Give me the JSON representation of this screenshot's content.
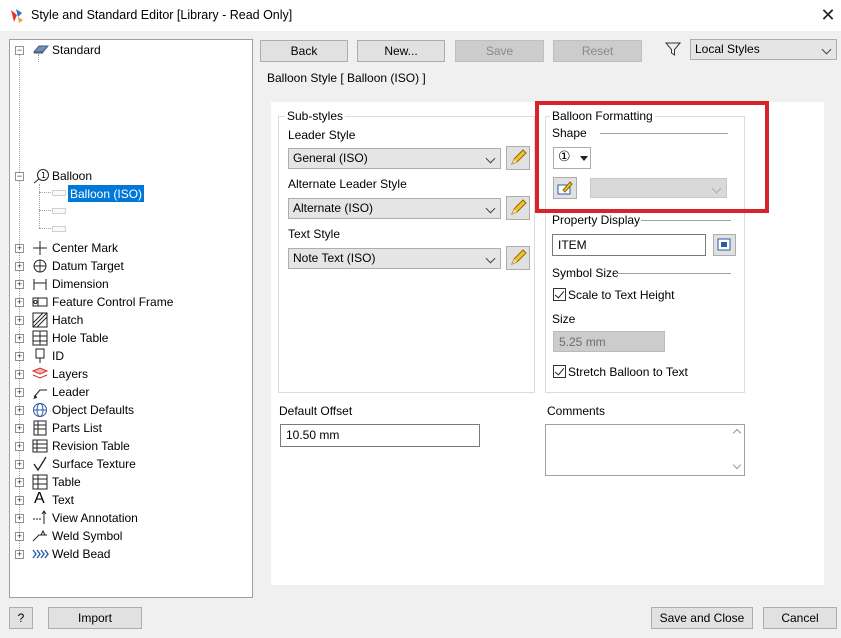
{
  "window": {
    "title": "Style and Standard Editor [Library - Read Only]",
    "close_icon": "close-icon"
  },
  "tree": {
    "root": {
      "label": "Standard",
      "icon": "standard-icon"
    },
    "balloon": {
      "label": "Balloon",
      "icon": "balloon-icon",
      "child": "Balloon (ISO)"
    },
    "items": [
      {
        "label": "Center Mark",
        "icon": "center-mark-icon"
      },
      {
        "label": "Datum Target",
        "icon": "datum-target-icon"
      },
      {
        "label": "Dimension",
        "icon": "dimension-icon"
      },
      {
        "label": "Feature Control Frame",
        "icon": "feature-control-frame-icon"
      },
      {
        "label": "Hatch",
        "icon": "hatch-icon"
      },
      {
        "label": "Hole Table",
        "icon": "hole-table-icon"
      },
      {
        "label": "ID",
        "icon": "id-icon"
      },
      {
        "label": "Layers",
        "icon": "layers-icon"
      },
      {
        "label": "Leader",
        "icon": "leader-icon"
      },
      {
        "label": "Object Defaults",
        "icon": "object-defaults-icon"
      },
      {
        "label": "Parts List",
        "icon": "parts-list-icon"
      },
      {
        "label": "Revision Table",
        "icon": "revision-table-icon"
      },
      {
        "label": "Surface Texture",
        "icon": "surface-texture-icon"
      },
      {
        "label": "Table",
        "icon": "table-icon"
      },
      {
        "label": "Text",
        "icon": "text-icon"
      },
      {
        "label": "View Annotation",
        "icon": "view-annotation-icon"
      },
      {
        "label": "Weld Symbol",
        "icon": "weld-symbol-icon"
      },
      {
        "label": "Weld Bead",
        "icon": "weld-bead-icon"
      }
    ]
  },
  "toolbar": {
    "back": "Back",
    "new": "New...",
    "save": "Save",
    "reset": "Reset",
    "filter_value": "Local Styles"
  },
  "style_header": "Balloon Style [ Balloon (ISO) ]",
  "substyles": {
    "group_label": "Sub-styles",
    "leader_style_label": "Leader Style",
    "leader_style_value": "General (ISO)",
    "alt_leader_label": "Alternate Leader Style",
    "alt_leader_value": "Alternate (ISO)",
    "text_style_label": "Text Style",
    "text_style_value": "Note Text (ISO)"
  },
  "formatting": {
    "group_label": "Balloon Formatting",
    "shape_label": "Shape",
    "shape_glyph": "①",
    "property_display_label": "Property Display",
    "property_display_value": "ITEM",
    "symbol_size_label": "Symbol Size",
    "scale_to_text_label": "Scale to Text Height",
    "scale_to_text_checked": true,
    "size_label": "Size",
    "size_value": "5.25 mm",
    "stretch_label": "Stretch Balloon to Text",
    "stretch_checked": true
  },
  "default_offset": {
    "label": "Default Offset",
    "value": "10.50 mm"
  },
  "comments": {
    "label": "Comments",
    "value": ""
  },
  "bottom": {
    "help": "?",
    "import": "Import",
    "save_close": "Save and Close",
    "cancel": "Cancel"
  },
  "colors": {
    "highlight": "#0078d7",
    "annotation_box": "#d8232a"
  }
}
